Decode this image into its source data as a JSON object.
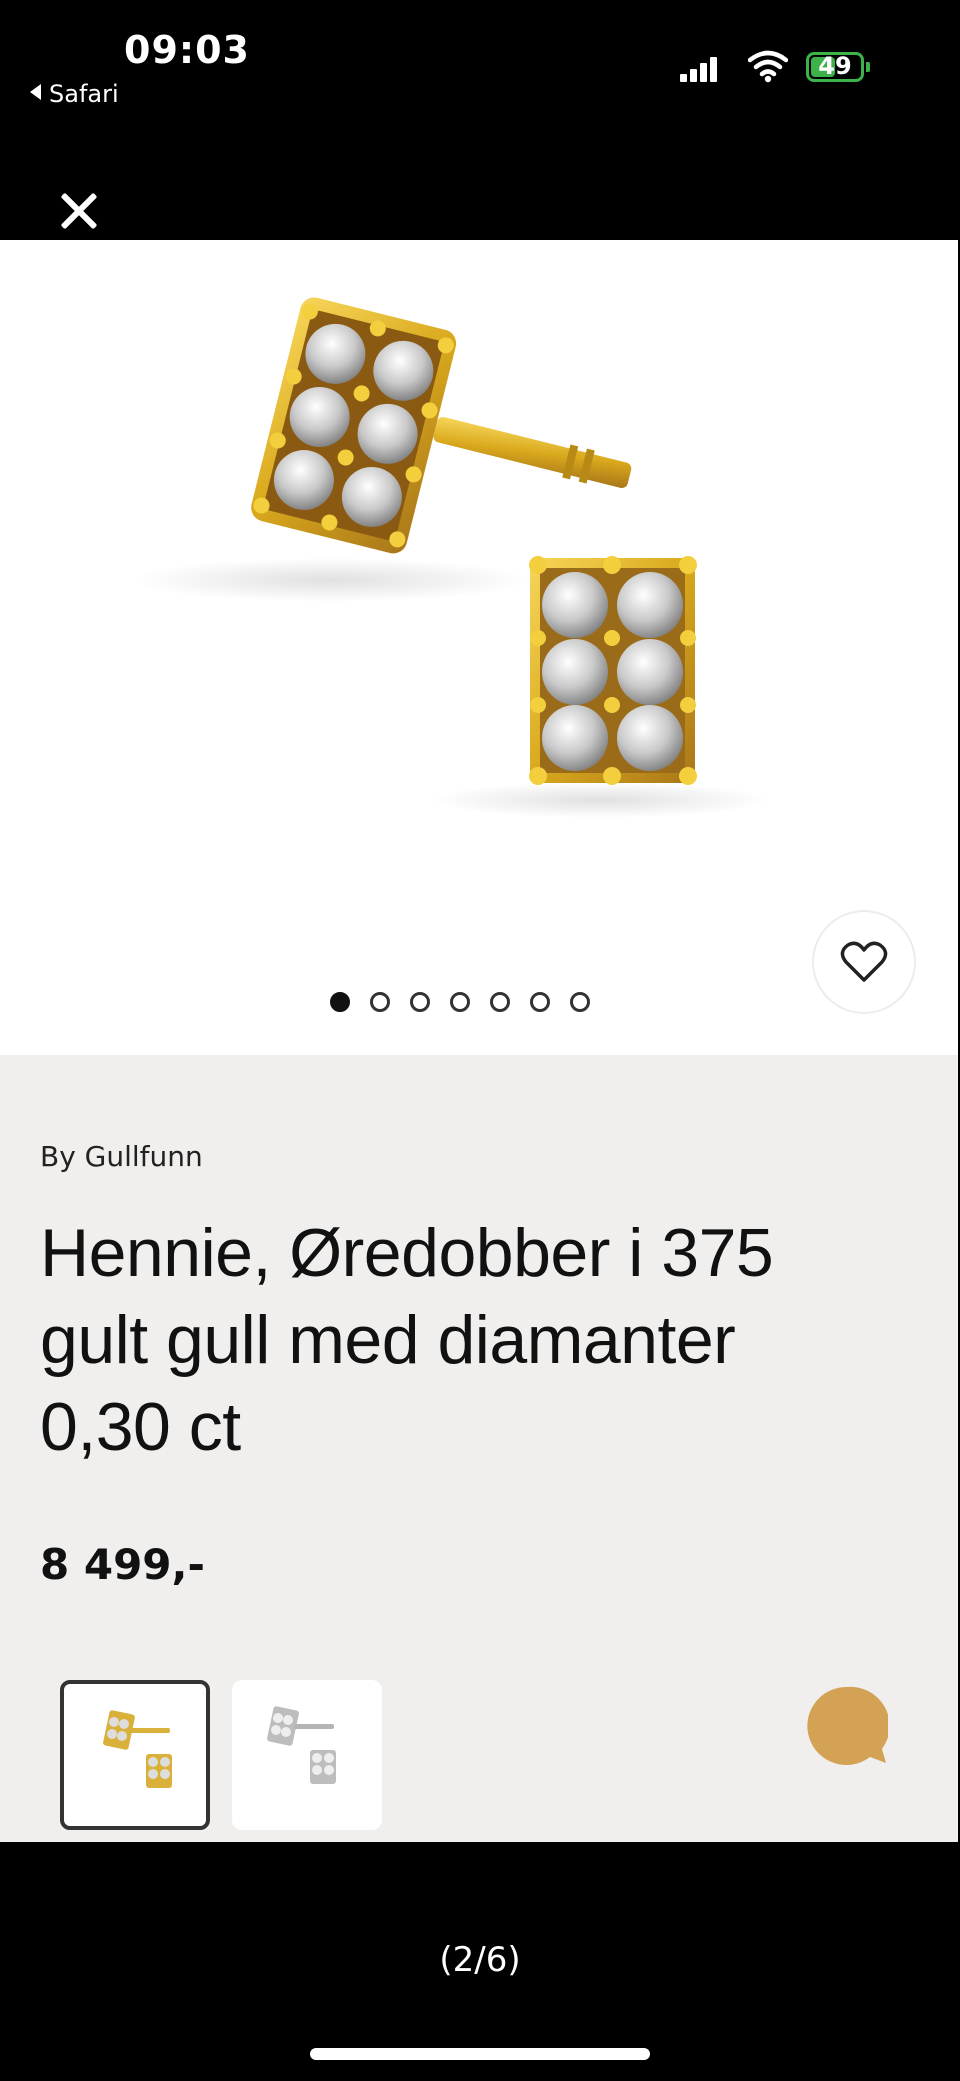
{
  "status_bar": {
    "time": "09:03",
    "back_app": "Safari",
    "battery": "49"
  },
  "gallery": {
    "image_count": 7,
    "active_index": 0,
    "favorite_icon": "heart-icon",
    "close_icon": "close-icon"
  },
  "product": {
    "brand": "By Gullfunn",
    "title": "Hennie, Øredobber i 375 gult gull med diamanter 0,30 ct",
    "price": "8 499,-"
  },
  "variants": [
    {
      "metal": "gult gull",
      "selected": true,
      "color": "#d9b13a"
    },
    {
      "metal": "hvitt gull",
      "selected": false,
      "color": "#c8c8c8"
    }
  ],
  "chat": {
    "icon": "chat-bubble-icon",
    "color": "#d4a255"
  },
  "viewer": {
    "counter": "(2/6)"
  }
}
